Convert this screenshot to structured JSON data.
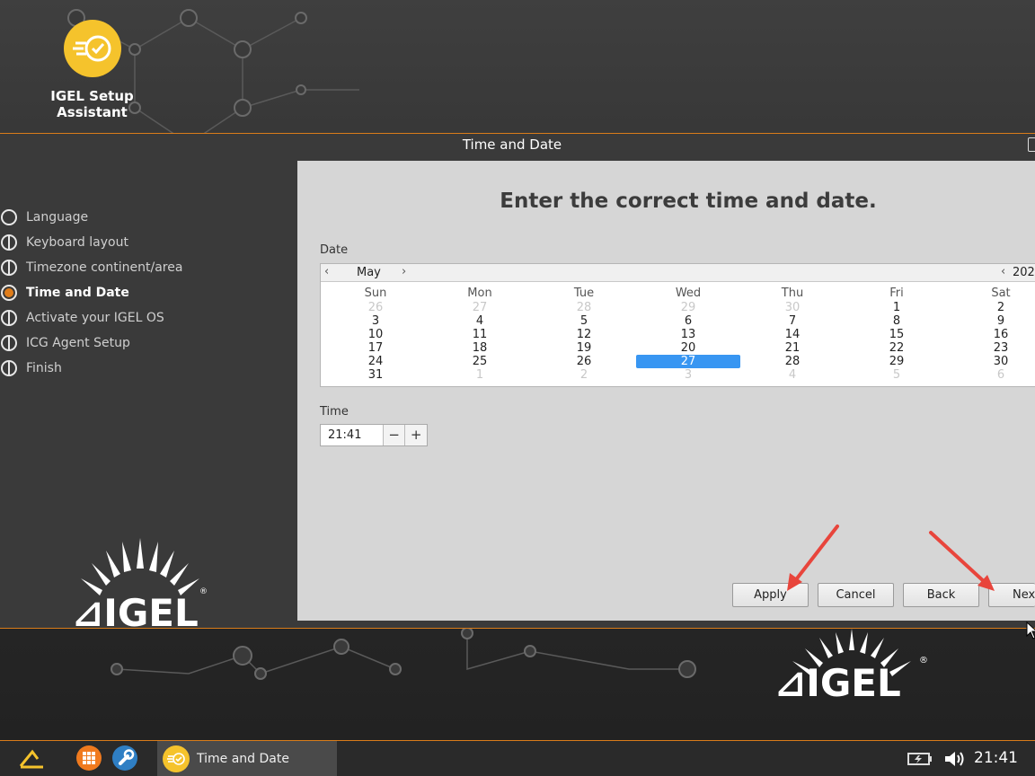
{
  "app_badge": {
    "label_line1": "IGEL Setup",
    "label_line2": "Assistant",
    "icon": "checkmark-speed-icon"
  },
  "window": {
    "title": "Time and Date"
  },
  "steps": [
    {
      "label": "Language",
      "active": false
    },
    {
      "label": "Keyboard layout",
      "active": false
    },
    {
      "label": "Timezone continent/area",
      "active": false
    },
    {
      "label": "Time and Date",
      "active": true
    },
    {
      "label": "Activate your IGEL OS",
      "active": false
    },
    {
      "label": "ICG Agent Setup",
      "active": false
    },
    {
      "label": "Finish",
      "active": false
    }
  ],
  "content": {
    "heading": "Enter the correct time and date.",
    "date_label": "Date",
    "time_label": "Time"
  },
  "calendar": {
    "prev_icon": "chevron-left-icon",
    "next_icon": "chevron-right-icon",
    "month": "May",
    "year": "202",
    "weekdays": [
      "Sun",
      "Mon",
      "Tue",
      "Wed",
      "Thu",
      "Fri",
      "Sat"
    ],
    "weeks": [
      [
        "26",
        "27",
        "28",
        "29",
        "30",
        "1",
        "2"
      ],
      [
        "3",
        "4",
        "5",
        "6",
        "7",
        "8",
        "9"
      ],
      [
        "10",
        "11",
        "12",
        "13",
        "14",
        "15",
        "16"
      ],
      [
        "17",
        "18",
        "19",
        "20",
        "21",
        "22",
        "23"
      ],
      [
        "24",
        "25",
        "26",
        "27",
        "28",
        "29",
        "30"
      ],
      [
        "31",
        "1",
        "2",
        "3",
        "4",
        "5",
        "6"
      ]
    ],
    "selected_day": "27"
  },
  "time": {
    "value": "21:41",
    "minus": "−",
    "plus": "+"
  },
  "buttons": {
    "apply": "Apply",
    "cancel": "Cancel",
    "back": "Back",
    "next": "Nex"
  },
  "taskbar": {
    "task_label": "Time and Date",
    "clock": "21:41",
    "icons": [
      "igel-start-icon",
      "apps-grid-icon",
      "wrench-icon",
      "battery-icon",
      "volume-icon"
    ]
  },
  "colors": {
    "accent": "#d97c1a",
    "selection": "#3896f2",
    "badge": "#f5c32c"
  }
}
